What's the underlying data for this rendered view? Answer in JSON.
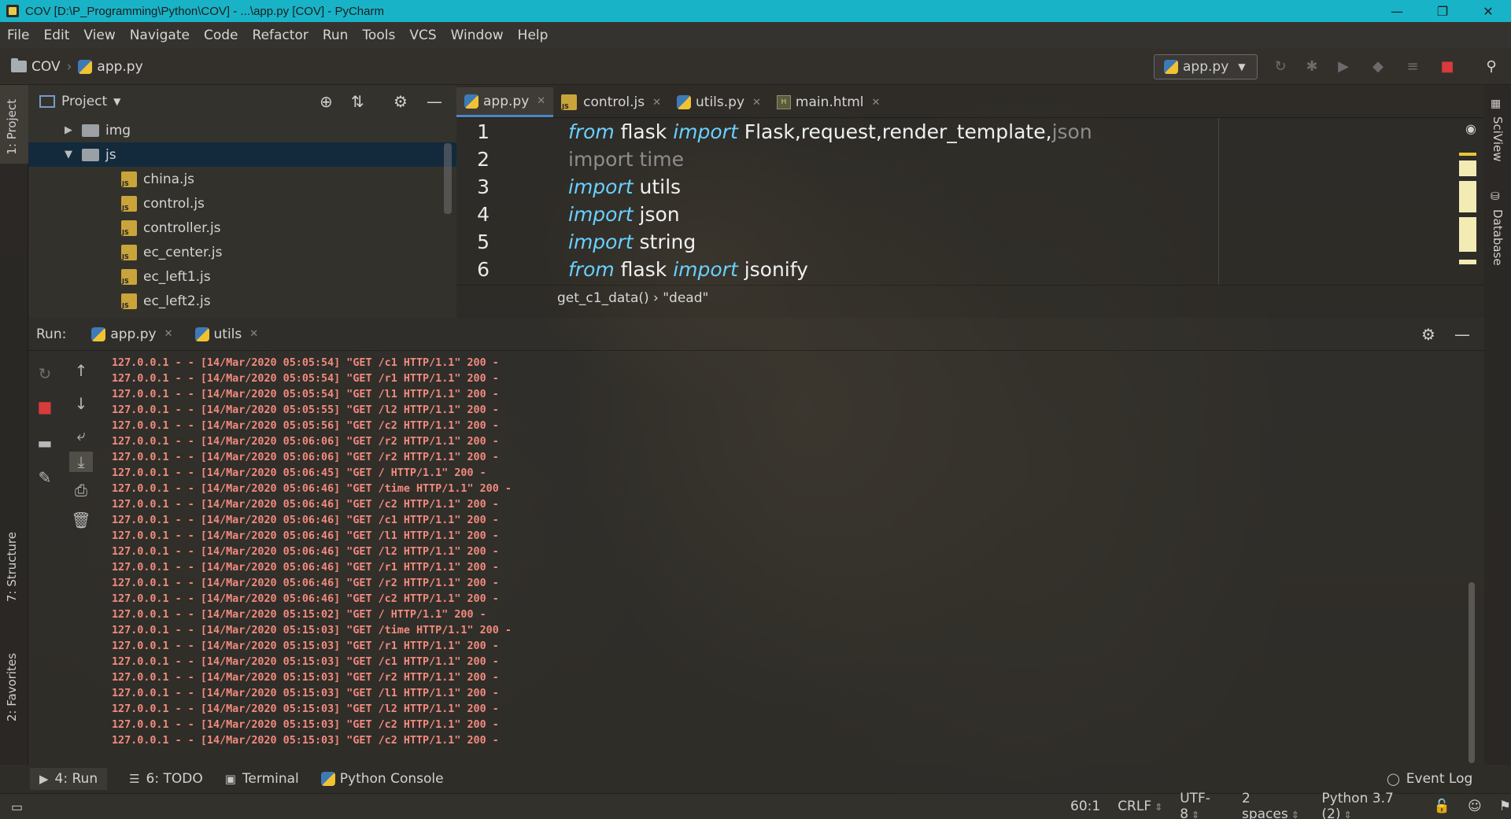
{
  "window": {
    "title": "COV [D:\\P_Programming\\Python\\COV] - ...\\app.py [COV] - PyCharm",
    "minimize": "—",
    "restore": "❐",
    "close": "✕"
  },
  "menu": [
    "File",
    "Edit",
    "View",
    "Navigate",
    "Code",
    "Refactor",
    "Run",
    "Tools",
    "VCS",
    "Window",
    "Help"
  ],
  "nav": {
    "project": "COV",
    "file": "app.py",
    "run_config": "app.py"
  },
  "left_strip": {
    "project_tab": "1: Project",
    "structure_tab": "7: Structure",
    "favorites_tab": "2: Favorites"
  },
  "right_strip": {
    "sciview_tab": "SciView",
    "database_tab": "Database"
  },
  "project_panel": {
    "title": "Project",
    "tree": [
      {
        "name": "img",
        "type": "folder",
        "expanded": false
      },
      {
        "name": "js",
        "type": "folder",
        "expanded": true
      },
      {
        "name": "china.js",
        "type": "js"
      },
      {
        "name": "control.js",
        "type": "js"
      },
      {
        "name": "controller.js",
        "type": "js"
      },
      {
        "name": "ec_center.js",
        "type": "js"
      },
      {
        "name": "ec_left1.js",
        "type": "js"
      },
      {
        "name": "ec_left2.js",
        "type": "js"
      }
    ]
  },
  "editor": {
    "tabs": [
      {
        "label": "app.py",
        "type": "py",
        "active": true
      },
      {
        "label": "control.js",
        "type": "js",
        "active": false
      },
      {
        "label": "utils.py",
        "type": "py",
        "active": false
      },
      {
        "label": "main.html",
        "type": "html",
        "active": false
      }
    ],
    "lines": [
      {
        "n": "1",
        "kw1": "from",
        "mid": " flask ",
        "kw2": "import",
        "rest": " Flask,request,render_template,",
        "dim": "json"
      },
      {
        "n": "2",
        "kw1": "",
        "mid": "",
        "kw2": "",
        "rest": "",
        "dim": "import time"
      },
      {
        "n": "3",
        "kw1": "import",
        "mid": " utils",
        "kw2": "",
        "rest": "",
        "dim": ""
      },
      {
        "n": "4",
        "kw1": "import",
        "mid": " json",
        "kw2": "",
        "rest": "",
        "dim": ""
      },
      {
        "n": "5",
        "kw1": "import",
        "mid": " string",
        "kw2": "",
        "rest": "",
        "dim": ""
      },
      {
        "n": "6",
        "kw1": "from",
        "mid": " flask ",
        "kw2": "import",
        "rest": " jsonify",
        "dim": ""
      }
    ],
    "breadcrumb": "get_c1_data()  ›  \"dead\""
  },
  "run_panel": {
    "label": "Run:",
    "tabs": [
      "app.py",
      "utils"
    ],
    "log": [
      "127.0.0.1 - - [14/Mar/2020 05:05:54] \"GET /c1 HTTP/1.1\" 200 -",
      "127.0.0.1 - - [14/Mar/2020 05:05:54] \"GET /r1 HTTP/1.1\" 200 -",
      "127.0.0.1 - - [14/Mar/2020 05:05:54] \"GET /l1 HTTP/1.1\" 200 -",
      "127.0.0.1 - - [14/Mar/2020 05:05:55] \"GET /l2 HTTP/1.1\" 200 -",
      "127.0.0.1 - - [14/Mar/2020 05:05:56] \"GET /c2 HTTP/1.1\" 200 -",
      "127.0.0.1 - - [14/Mar/2020 05:06:06] \"GET /r2 HTTP/1.1\" 200 -",
      "127.0.0.1 - - [14/Mar/2020 05:06:06] \"GET /r2 HTTP/1.1\" 200 -",
      "127.0.0.1 - - [14/Mar/2020 05:06:45] \"GET / HTTP/1.1\" 200 -",
      "127.0.0.1 - - [14/Mar/2020 05:06:46] \"GET /time HTTP/1.1\" 200 -",
      "127.0.0.1 - - [14/Mar/2020 05:06:46] \"GET /c2 HTTP/1.1\" 200 -",
      "127.0.0.1 - - [14/Mar/2020 05:06:46] \"GET /c1 HTTP/1.1\" 200 -",
      "127.0.0.1 - - [14/Mar/2020 05:06:46] \"GET /l1 HTTP/1.1\" 200 -",
      "127.0.0.1 - - [14/Mar/2020 05:06:46] \"GET /l2 HTTP/1.1\" 200 -",
      "127.0.0.1 - - [14/Mar/2020 05:06:46] \"GET /r1 HTTP/1.1\" 200 -",
      "127.0.0.1 - - [14/Mar/2020 05:06:46] \"GET /r2 HTTP/1.1\" 200 -",
      "127.0.0.1 - - [14/Mar/2020 05:06:46] \"GET /c2 HTTP/1.1\" 200 -",
      "127.0.0.1 - - [14/Mar/2020 05:15:02] \"GET / HTTP/1.1\" 200 -",
      "127.0.0.1 - - [14/Mar/2020 05:15:03] \"GET /time HTTP/1.1\" 200 -",
      "127.0.0.1 - - [14/Mar/2020 05:15:03] \"GET /r1 HTTP/1.1\" 200 -",
      "127.0.0.1 - - [14/Mar/2020 05:15:03] \"GET /c1 HTTP/1.1\" 200 -",
      "127.0.0.1 - - [14/Mar/2020 05:15:03] \"GET /r2 HTTP/1.1\" 200 -",
      "127.0.0.1 - - [14/Mar/2020 05:15:03] \"GET /l1 HTTP/1.1\" 200 -",
      "127.0.0.1 - - [14/Mar/2020 05:15:03] \"GET /l2 HTTP/1.1\" 200 -",
      "127.0.0.1 - - [14/Mar/2020 05:15:03] \"GET /c2 HTTP/1.1\" 200 -",
      "127.0.0.1 - - [14/Mar/2020 05:15:03] \"GET /c2 HTTP/1.1\" 200 -"
    ]
  },
  "bottom_tools": {
    "run": "4: Run",
    "todo": "6: TODO",
    "terminal": "Terminal",
    "python_console": "Python Console",
    "event_log": "Event Log"
  },
  "status": {
    "position": "60:1",
    "line_sep": "CRLF",
    "encoding": "UTF-8",
    "indent": "2 spaces",
    "interpreter": "Python 3.7 (2)"
  },
  "colors": {
    "titlebar": "#18b3c7",
    "keyword": "#6ad0ff",
    "log_text": "#f28a7e",
    "selection": "#0d293f",
    "stop": "#d83b3b"
  }
}
